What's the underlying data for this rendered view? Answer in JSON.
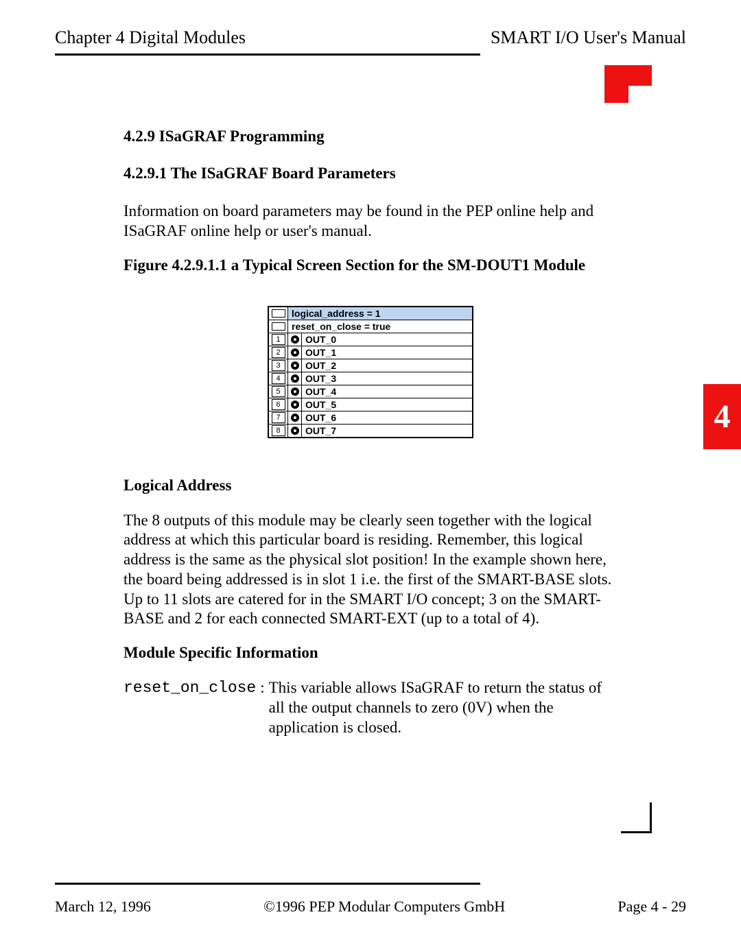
{
  "header": {
    "left": "Chapter 4  Digital Modules",
    "right": "SMART I/O User's Manual"
  },
  "section": {
    "num_title": "4.2.9 ISaGRAF Programming",
    "sub_num_title": "4.2.9.1 The ISaGRAF Board Parameters",
    "intro": "Information on board parameters may be found in the PEP online help and ISaGRAF online help or user's manual.",
    "figure_caption": "Figure 4.2.9.1.1 a Typical Screen Section for the SM-DOUT1 Module"
  },
  "figure": {
    "params": [
      {
        "label": "logical_address = 1",
        "highlight": true
      },
      {
        "label": "reset_on_close = true",
        "highlight": false
      }
    ],
    "rows": [
      {
        "idx": "1",
        "label": "OUT_0"
      },
      {
        "idx": "2",
        "label": "OUT_1"
      },
      {
        "idx": "3",
        "label": "OUT_2"
      },
      {
        "idx": "4",
        "label": "OUT_3"
      },
      {
        "idx": "5",
        "label": "OUT_4"
      },
      {
        "idx": "6",
        "label": "OUT_5"
      },
      {
        "idx": "7",
        "label": "OUT_6"
      },
      {
        "idx": "8",
        "label": "OUT_7"
      }
    ]
  },
  "logical_address": {
    "heading": "Logical Address",
    "body": "The 8 outputs of this module may be clearly seen together with the logical address at which this particular board is residing. Remember, this logical address is the same as the physical slot position! In the example shown here, the board being addressed is in slot 1 i.e. the first of the SMART-BASE slots. Up to 11 slots are catered for in the SMART I/O concept; 3 on the SMART-BASE and 2 for each connected SMART-EXT (up to a total of 4)."
  },
  "msi": {
    "heading": "Module Specific Information",
    "key": "reset_on_close",
    "colon": ":",
    "desc": "This variable allows ISaGRAF to return the status of all the output channels to zero (0V) when the application is closed."
  },
  "side_tab": "4",
  "footer": {
    "left": "March 12, 1996",
    "center": "©1996 PEP Modular Computers GmbH",
    "right": "Page 4 - 29"
  }
}
